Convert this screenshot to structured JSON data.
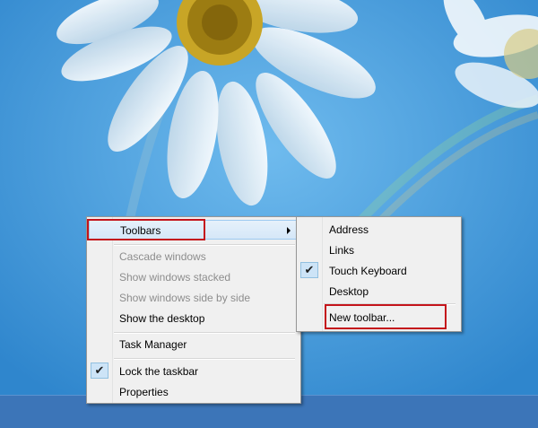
{
  "context_menu": {
    "items": [
      {
        "label": "Toolbars",
        "enabled": true,
        "submenu": true,
        "highlighted": true
      },
      {
        "label": "Cascade windows",
        "enabled": false
      },
      {
        "label": "Show windows stacked",
        "enabled": false
      },
      {
        "label": "Show windows side by side",
        "enabled": false
      },
      {
        "label": "Show the desktop",
        "enabled": true
      },
      {
        "label": "Task Manager",
        "enabled": true
      },
      {
        "label": "Lock the taskbar",
        "enabled": true,
        "checked": true
      },
      {
        "label": "Properties",
        "enabled": true
      }
    ]
  },
  "toolbars_submenu": {
    "items": [
      {
        "label": "Address",
        "checked": false
      },
      {
        "label": "Links",
        "checked": false
      },
      {
        "label": "Touch Keyboard",
        "checked": true
      },
      {
        "label": "Desktop",
        "checked": false
      },
      {
        "label": "New toolbar...",
        "checked": false
      }
    ]
  },
  "symbols": {
    "checkmark": "✔"
  },
  "colors": {
    "highlight_annotation": "#c4141b",
    "menu_background": "#f0f0f0",
    "desktop_background": "#3f9cdc",
    "taskbar": "#3c75b8"
  }
}
